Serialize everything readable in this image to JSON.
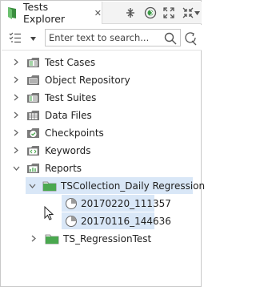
{
  "header": {
    "title": "Tests Explorer",
    "tab_icon": "tests-explorer-icon",
    "close_glyph": "✕",
    "actions": [
      "collapse-all-icon",
      "link-with-editor-icon",
      "expand-icon",
      "shrink-icon",
      "dropdown-arrow-icon"
    ]
  },
  "toolbar": {
    "filter_icon": "filter-list-icon",
    "search_placeholder": "Enter text to search...",
    "search_value": "",
    "search_icon": "search-icon",
    "advanced_search_icon": "advanced-search-icon"
  },
  "tree": {
    "items": [
      {
        "label": "Test Cases",
        "icon": "test-cases-folder-icon",
        "expanded": false
      },
      {
        "label": "Object Repository",
        "icon": "object-repository-folder-icon",
        "expanded": false
      },
      {
        "label": "Test Suites",
        "icon": "test-suites-folder-icon",
        "expanded": false
      },
      {
        "label": "Data Files",
        "icon": "data-files-folder-icon",
        "expanded": false
      },
      {
        "label": "Checkpoints",
        "icon": "checkpoints-folder-icon",
        "expanded": false
      },
      {
        "label": "Keywords",
        "icon": "keywords-folder-icon",
        "expanded": false
      },
      {
        "label": "Reports",
        "icon": "reports-folder-icon",
        "expanded": true,
        "children": [
          {
            "label": "TSCollection_Daily Regression",
            "icon": "collection-folder-icon",
            "expanded": true,
            "selected": true,
            "children": [
              {
                "label": "20170220_111357",
                "icon": "report-pie-icon",
                "selected": true
              },
              {
                "label": "20170116_144636",
                "icon": "report-pie-icon",
                "selected": true
              }
            ]
          },
          {
            "label": "TS_RegressionTest",
            "icon": "suite-folder-icon",
            "expanded": false
          }
        ]
      }
    ]
  },
  "colors": {
    "selection": "#d9e7f7",
    "folder_green": "#4aa84f",
    "folder_gray": "#7c7c7c"
  }
}
